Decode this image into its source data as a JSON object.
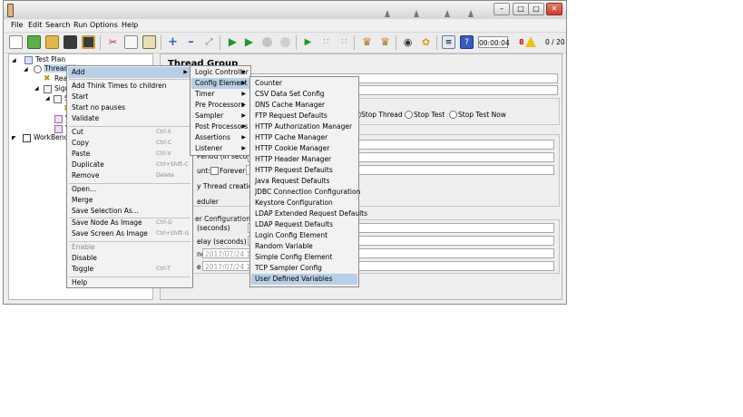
{
  "menubar": {
    "items": [
      "File",
      "Edit",
      "Search",
      "Run",
      "Options",
      "Help"
    ]
  },
  "toolbar": {
    "timer": "00:00:04",
    "warning_count": "8",
    "threads": "0 / 20"
  },
  "tree": {
    "test_plan": "Test Plan",
    "thread_group": "Thread G",
    "child1": "Read",
    "child2": "Signi",
    "child3": "S",
    "child4": "V",
    "child5": "V",
    "workbench": "WorkBench"
  },
  "right_panel": {
    "title": "Thread Group",
    "stop_thread": "Stop Thread",
    "stop_test": "Stop Test",
    "stop_test_now": "Stop Test Now",
    "ramp_fragment": "Period (in second",
    "loop_fragment": "unt:",
    "forever_label": "Forever",
    "loop_value": "1",
    "delay_fragment": "y Thread creation u",
    "scheduler_fragment": "eduler",
    "sched_config": "er Configuration",
    "duration": "(seconds)",
    "startup_delay": "elay (seconds)",
    "start_time_label": "ne",
    "start_time_value": "2017/07/24 18:4",
    "end_time_label": "e",
    "end_time_value": "2017/07/24 18:4"
  },
  "context_menu": {
    "items": [
      {
        "label": "Add",
        "arrow": true,
        "highlight": true
      },
      {
        "label": "Add Think Times to children"
      },
      {
        "label": "Start"
      },
      {
        "label": "Start no pauses"
      },
      {
        "label": "Validate"
      },
      {
        "label": "Cut",
        "shortcut": "Ctrl-X"
      },
      {
        "label": "Copy",
        "shortcut": "Ctrl-C"
      },
      {
        "label": "Paste",
        "shortcut": "Ctrl-V"
      },
      {
        "label": "Duplicate",
        "shortcut": "Ctrl+Shift-C"
      },
      {
        "label": "Remove",
        "shortcut": "Delete"
      },
      {
        "label": "Open..."
      },
      {
        "label": "Merge"
      },
      {
        "label": "Save Selection As..."
      },
      {
        "label": "Save Node As Image",
        "shortcut": "Ctrl-G"
      },
      {
        "label": "Save Screen As Image",
        "shortcut": "Ctrl+Shift-G"
      },
      {
        "label": "Enable",
        "disabled": true
      },
      {
        "label": "Disable"
      },
      {
        "label": "Toggle",
        "shortcut": "Ctrl-T"
      },
      {
        "label": "Help"
      }
    ]
  },
  "add_submenu": {
    "items": [
      {
        "label": "Logic Controller"
      },
      {
        "label": "Config Element",
        "highlight": true
      },
      {
        "label": "Timer"
      },
      {
        "label": "Pre Processors"
      },
      {
        "label": "Sampler"
      },
      {
        "label": "Post Processors"
      },
      {
        "label": "Assertions"
      },
      {
        "label": "Listener"
      }
    ]
  },
  "config_submenu": {
    "items": [
      "Counter",
      "CSV Data Set Config",
      "DNS Cache Manager",
      "FTP Request Defaults",
      "HTTP Authorization Manager",
      "HTTP Cache Manager",
      "HTTP Cookie Manager",
      "HTTP Header Manager",
      "HTTP Request Defaults",
      "Java Request Defaults",
      "JDBC Connection Configuration",
      "Keystore Configuration",
      "LDAP Extended Request Defaults",
      "LDAP Request Defaults",
      "Login Config Element",
      "Random Variable",
      "Simple Config Element",
      "TCP Sampler Config",
      "User Defined Variables"
    ],
    "highlight_index": 18
  }
}
